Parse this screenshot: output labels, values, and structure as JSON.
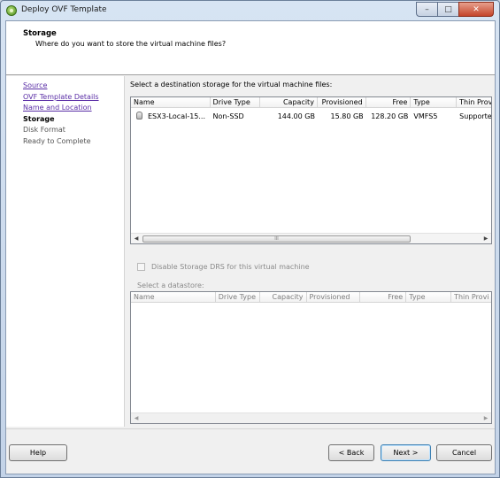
{
  "window": {
    "title": "Deploy OVF Template",
    "buttons": {
      "minimize": "–",
      "maximize": "□",
      "close": "✕"
    }
  },
  "header": {
    "title": "Storage",
    "subtitle": "Where do you want to store the virtual machine files?"
  },
  "steps": [
    {
      "label": "Source",
      "state": "link"
    },
    {
      "label": "OVF Template Details",
      "state": "link"
    },
    {
      "label": "Name and Location",
      "state": "link"
    },
    {
      "label": "Storage",
      "state": "current"
    },
    {
      "label": "Disk Format",
      "state": "pending"
    },
    {
      "label": "Ready to Complete",
      "state": "pending"
    }
  ],
  "destination": {
    "instruction": "Select a destination storage for the virtual machine files:",
    "columns": [
      "Name",
      "Drive Type",
      "Capacity",
      "Provisioned",
      "Free",
      "Type",
      "Thin Prov"
    ],
    "rows": [
      {
        "name": "ESX3-Local-15...",
        "drive_type": "Non-SSD",
        "capacity": "144.00 GB",
        "provisioned": "15.80 GB",
        "free": "128.20 GB",
        "type": "VMFS5",
        "thin": "Supporte"
      }
    ],
    "scroll_thumb": "III"
  },
  "drs": {
    "label": "Disable Storage DRS for this virtual machine",
    "checked": false,
    "enabled": false
  },
  "datastore": {
    "label": "Select a datastore:",
    "columns": [
      "Name",
      "Drive Type",
      "Capacity",
      "Provisioned",
      "Free",
      "Type",
      "Thin Provi"
    ]
  },
  "footer": {
    "help": "Help",
    "back": "< Back",
    "next": "Next >",
    "cancel": "Cancel"
  },
  "colors": {
    "link": "#5a2ea6",
    "titlebar": "#c3d3e8",
    "close": "#c4442a"
  }
}
